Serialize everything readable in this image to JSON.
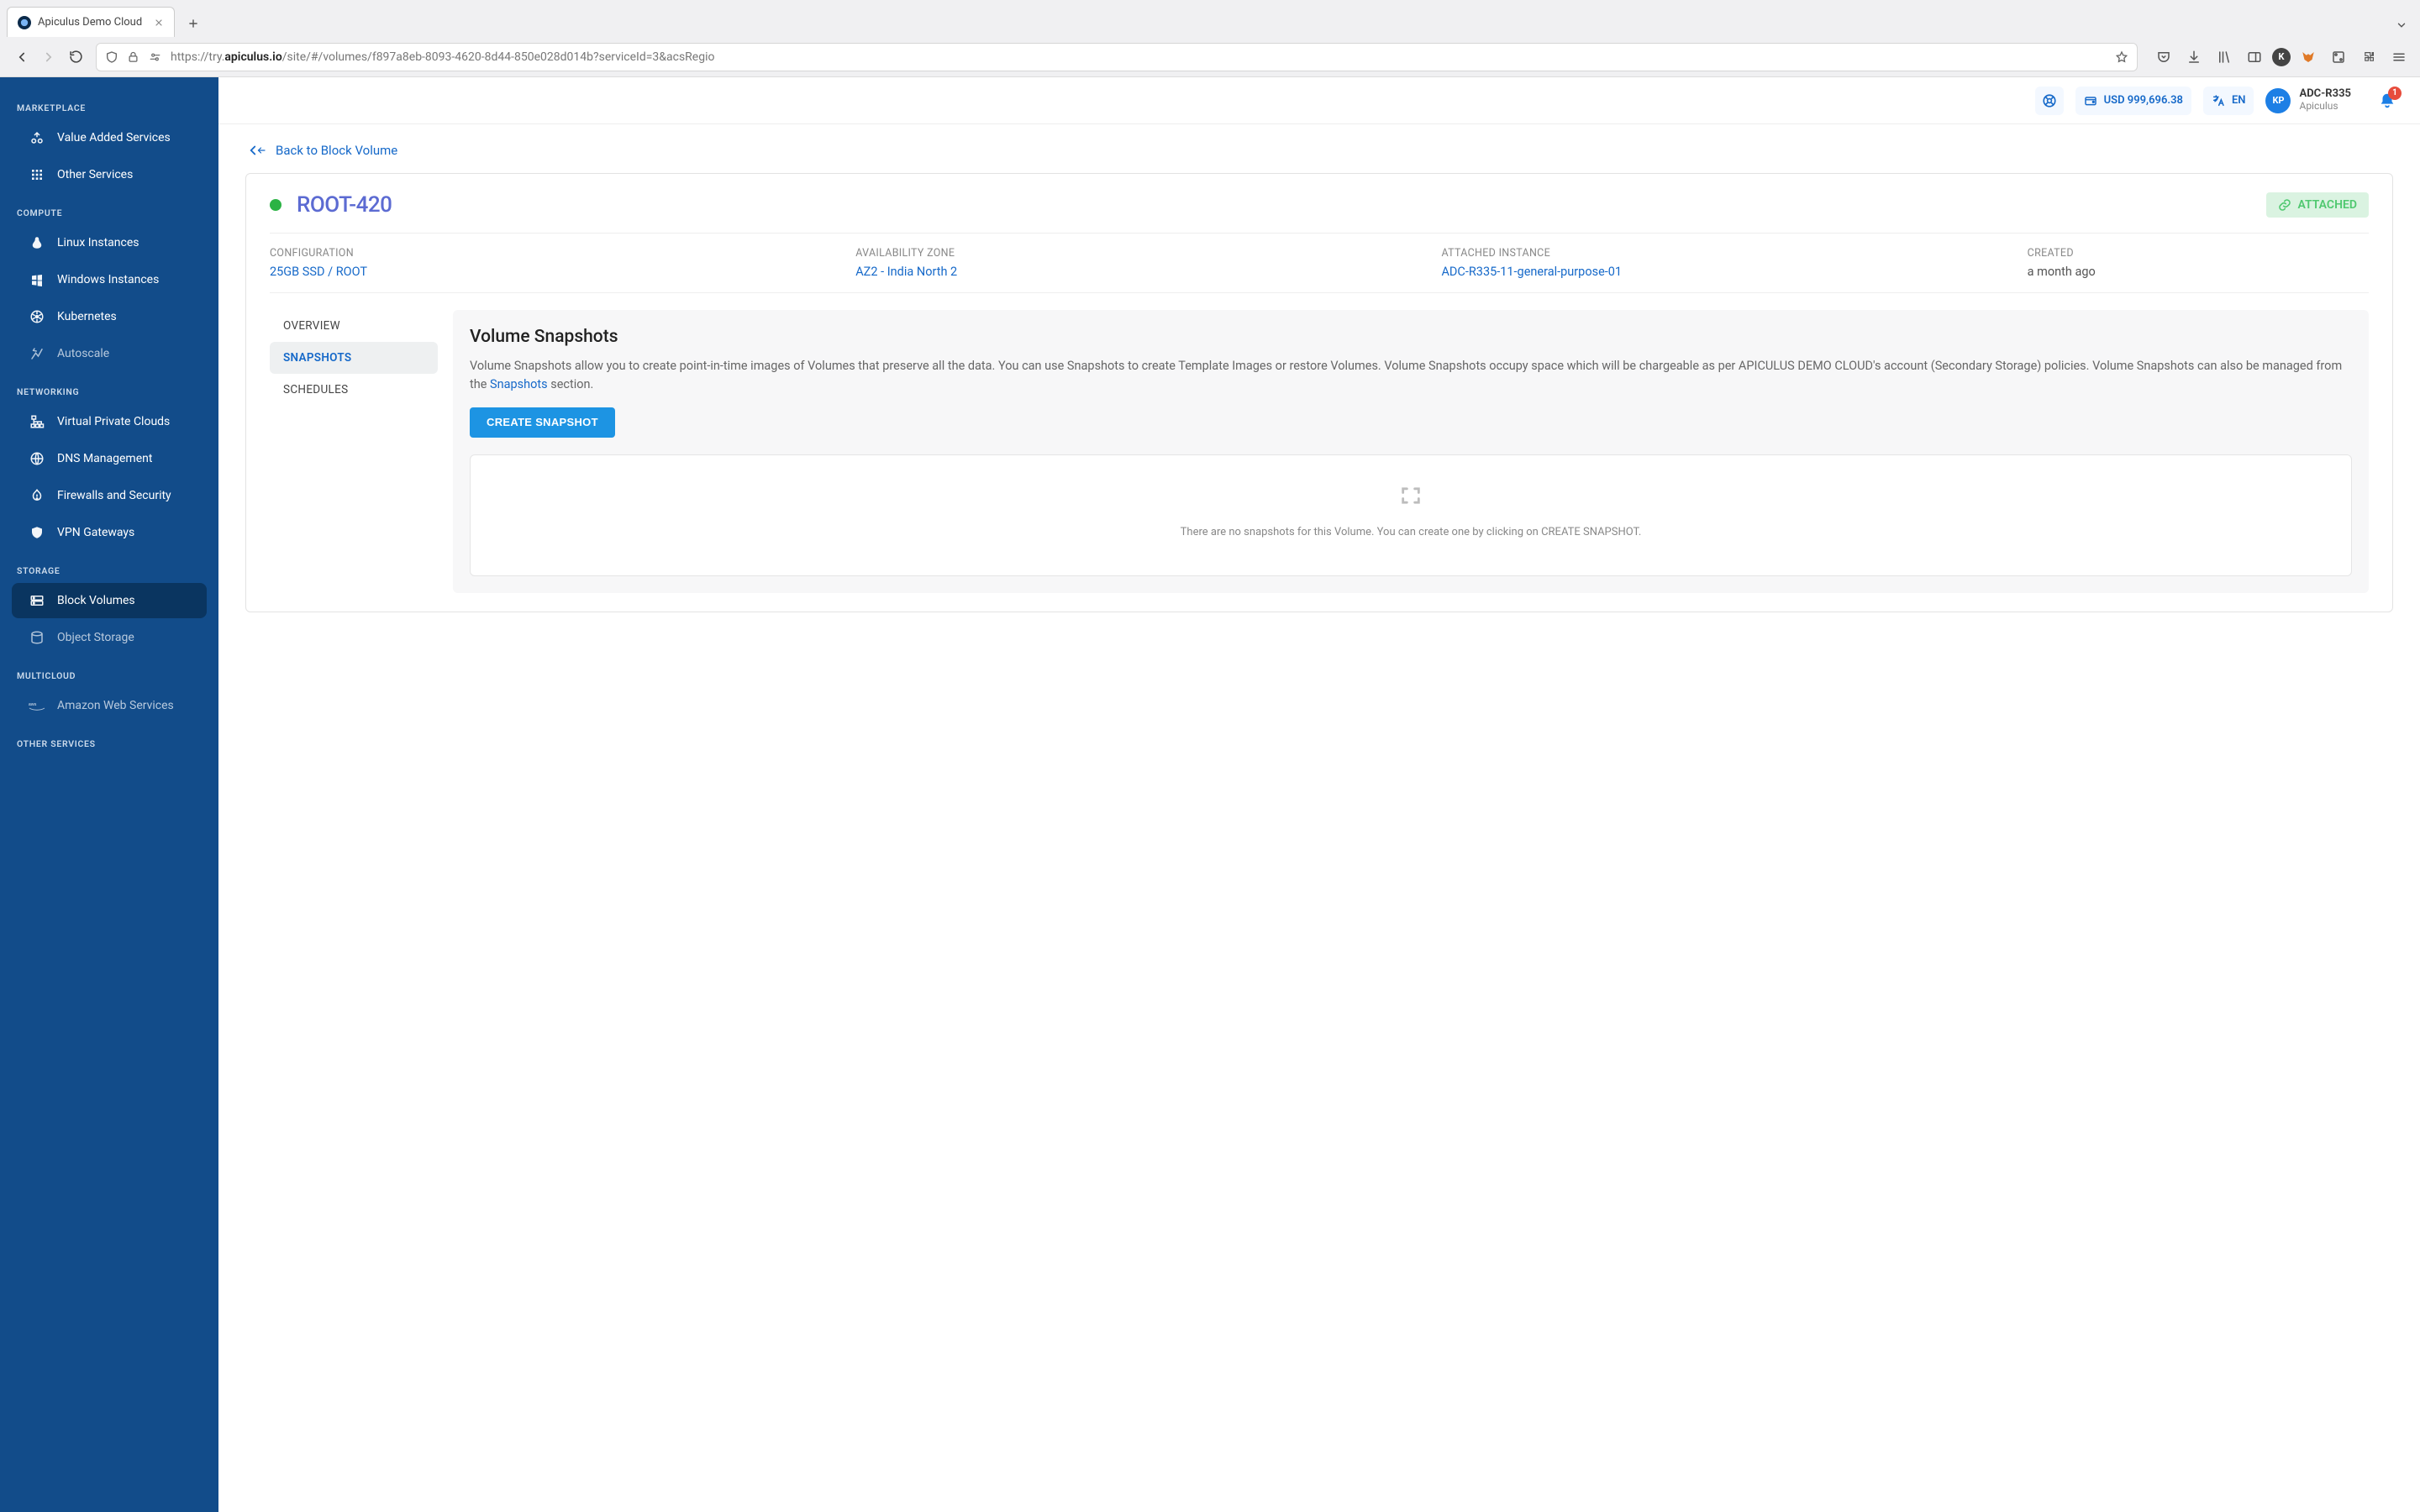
{
  "browser": {
    "tab_title": "Apiculus Demo Cloud",
    "url_prefix": "https://try.",
    "url_host": "apiculus.io",
    "url_rest": "/site/#/volumes/f897a8eb-8093-4620-8d44-850e028d014b?serviceId=3&acsRegio"
  },
  "topbar": {
    "balance": "USD 999,696.38",
    "language": "EN",
    "user": {
      "initials": "KP",
      "name": "ADC-R335",
      "org": "Apiculus"
    },
    "notifications": "1"
  },
  "sidebar": {
    "sections": [
      {
        "heading": "MARKETPLACE",
        "items": [
          {
            "label": "Value Added Services",
            "icon": "vas",
            "disabled": false
          },
          {
            "label": "Other Services",
            "icon": "grid",
            "disabled": false
          }
        ]
      },
      {
        "heading": "COMPUTE",
        "items": [
          {
            "label": "Linux Instances",
            "icon": "linux",
            "disabled": false
          },
          {
            "label": "Windows Instances",
            "icon": "windows",
            "disabled": false
          },
          {
            "label": "Kubernetes",
            "icon": "kube",
            "disabled": false
          },
          {
            "label": "Autoscale",
            "icon": "autoscale",
            "disabled": true
          }
        ]
      },
      {
        "heading": "NETWORKING",
        "items": [
          {
            "label": "Virtual Private Clouds",
            "icon": "vpc",
            "disabled": false
          },
          {
            "label": "DNS Management",
            "icon": "dns",
            "disabled": false
          },
          {
            "label": "Firewalls and Security",
            "icon": "firewall",
            "disabled": false
          },
          {
            "label": "VPN Gateways",
            "icon": "vpn",
            "disabled": false
          }
        ]
      },
      {
        "heading": "STORAGE",
        "items": [
          {
            "label": "Block Volumes",
            "icon": "block",
            "disabled": false,
            "active": true
          },
          {
            "label": "Object Storage",
            "icon": "object",
            "disabled": true
          }
        ]
      },
      {
        "heading": "MULTICLOUD",
        "items": [
          {
            "label": "Amazon Web Services",
            "icon": "aws",
            "disabled": true
          }
        ]
      },
      {
        "heading": "OTHER SERVICES",
        "items": []
      }
    ]
  },
  "page": {
    "back_label": "Back to Block Volume",
    "title": "ROOT-420",
    "status_badge": "ATTACHED",
    "meta": {
      "configuration": {
        "label": "CONFIGURATION",
        "value": "25GB SSD / ROOT"
      },
      "zone": {
        "label": "AVAILABILITY ZONE",
        "value": "AZ2 - India North 2"
      },
      "attached": {
        "label": "ATTACHED INSTANCE",
        "value": "ADC-R335-11-general-purpose-01"
      },
      "created": {
        "label": "CREATED",
        "value": "a month ago"
      }
    },
    "tabs": [
      {
        "label": "OVERVIEW"
      },
      {
        "label": "SNAPSHOTS",
        "active": true
      },
      {
        "label": "SCHEDULES"
      }
    ],
    "pane": {
      "heading": "Volume Snapshots",
      "desc_before": "Volume Snapshots allow you to create point-in-time images of Volumes that preserve all the data. You can use Snapshots to create Template Images or restore Volumes. Volume Snapshots occupy space which will be chargeable as per APICULUS DEMO CLOUD's account (Secondary Storage) policies. Volume Snapshots can also be managed from the ",
      "desc_link": "Snapshots",
      "desc_after": " section.",
      "button": "CREATE SNAPSHOT",
      "empty": "There are no snapshots for this Volume. You can create one by clicking on CREATE SNAPSHOT."
    }
  }
}
